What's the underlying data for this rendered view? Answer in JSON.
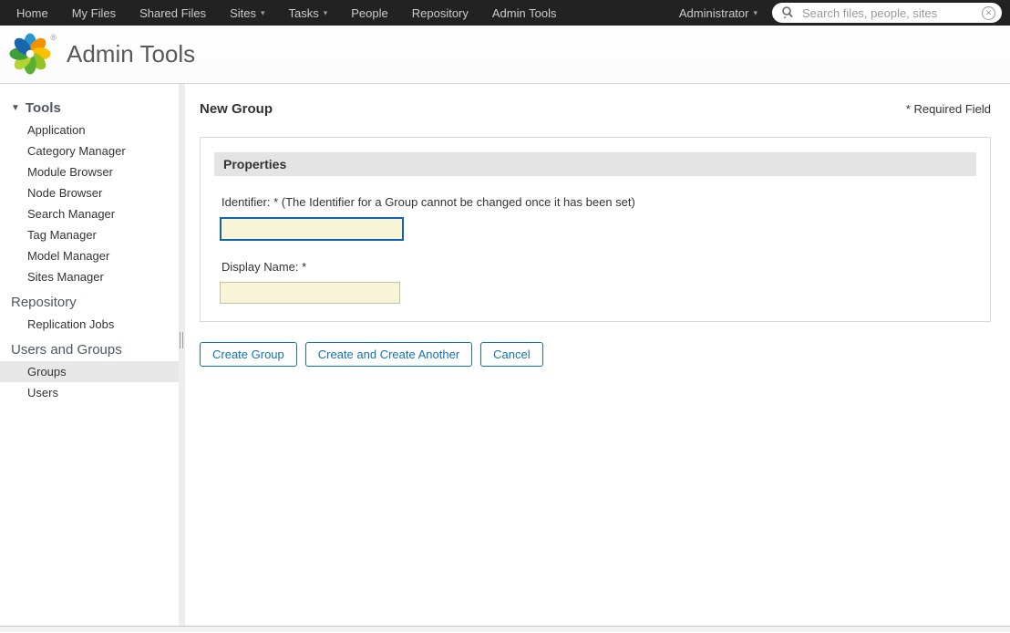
{
  "topnav": {
    "items": [
      "Home",
      "My Files",
      "Shared Files",
      "Sites",
      "Tasks",
      "People",
      "Repository",
      "Admin Tools"
    ],
    "user_menu": "Administrator",
    "search": {
      "placeholder": "Search files, people, sites",
      "value": ""
    }
  },
  "header": {
    "title": "Admin Tools"
  },
  "sidebar": {
    "sections": [
      {
        "label": "Tools",
        "items": [
          "Application",
          "Category Manager",
          "Module Browser",
          "Node Browser",
          "Search Manager",
          "Tag Manager",
          "Model Manager",
          "Sites Manager"
        ]
      },
      {
        "label": "Repository",
        "items": [
          "Replication Jobs"
        ]
      },
      {
        "label": "Users and Groups",
        "items": [
          "Groups",
          "Users"
        ],
        "selected_item": "Groups"
      }
    ]
  },
  "main": {
    "title": "New Group",
    "required_note": "* Required Field",
    "panel": {
      "header": "Properties",
      "fields": [
        {
          "label": "Identifier: * (The Identifier for a Group cannot be changed once it has been set)",
          "value": "",
          "focused": true
        },
        {
          "label": "Display Name: *",
          "value": "",
          "focused": false
        }
      ]
    },
    "buttons": [
      "Create Group",
      "Create and Create Another",
      "Cancel"
    ]
  },
  "icons": {
    "caret_down": "▾",
    "collapse_triangle": "▼",
    "clear": "✕",
    "registered": "®"
  },
  "colors": {
    "topnav_bg": "#222222",
    "accent_blue": "#1273b4",
    "focus_border": "#1062af",
    "input_bg": "#f8f5d7",
    "selected_row": "#e7e7e7",
    "panel_header_bg": "#e4e4e4"
  }
}
